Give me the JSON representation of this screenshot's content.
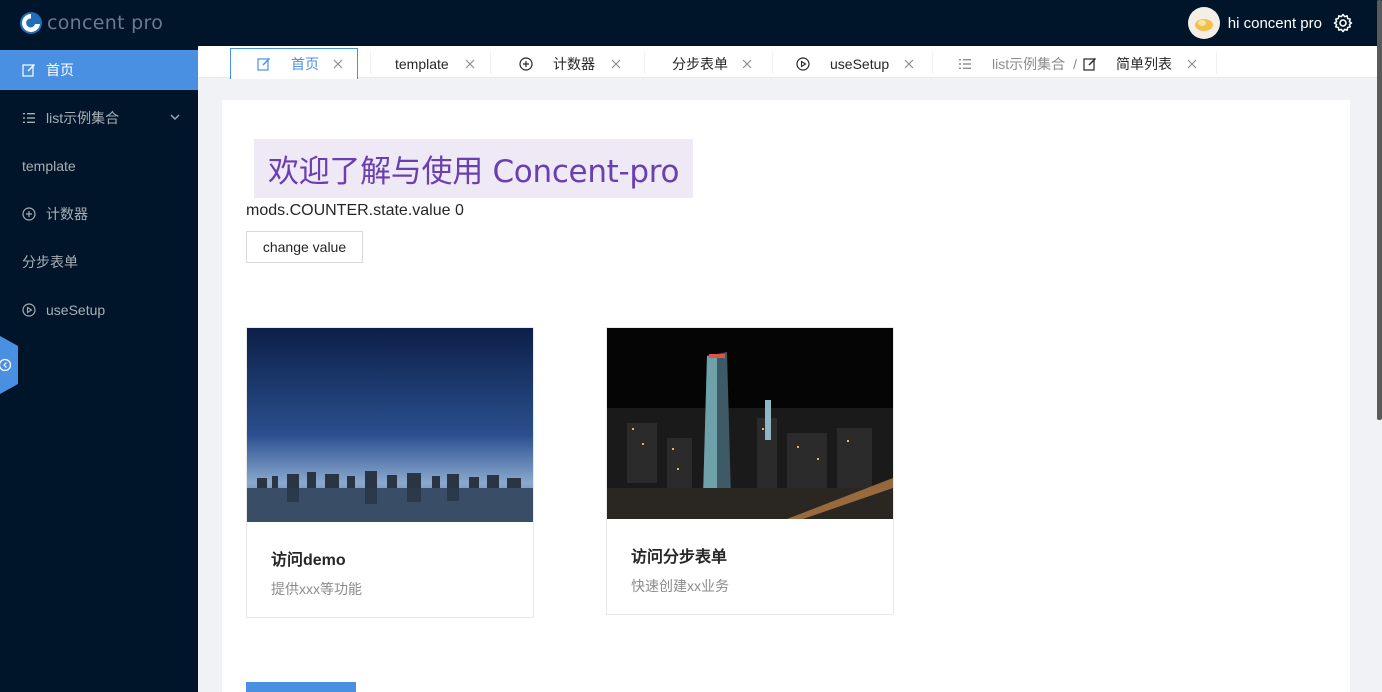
{
  "app": {
    "logo_text": "concent pro",
    "user_greeting": "hi concent pro"
  },
  "sidebar": {
    "items": [
      {
        "label": "首页",
        "icon": "edit-icon",
        "active": true
      },
      {
        "label": "list示例集合",
        "icon": "list-icon",
        "has_submenu": true
      },
      {
        "label": "template"
      },
      {
        "label": "计数器",
        "icon": "plus-circle-icon"
      },
      {
        "label": "分步表单"
      },
      {
        "label": "useSetup",
        "icon": "play-circle-icon"
      }
    ]
  },
  "tabs": [
    {
      "label": "首页",
      "icon": "edit-icon",
      "active": true
    },
    {
      "label": "template"
    },
    {
      "label": "计数器",
      "icon": "plus-circle-icon"
    },
    {
      "label": "分步表单"
    },
    {
      "label": "useSetup",
      "icon": "play-circle-icon"
    },
    {
      "parent": "list示例集合",
      "separator": "/",
      "label": "简单列表",
      "icon": "edit-icon",
      "parent_icon": "list-icon"
    }
  ],
  "main": {
    "welcome_title": "欢迎了解与使用 Concent-pro",
    "counter_text": "mods.COUNTER.state.value 0",
    "change_button": "change value",
    "cards": [
      {
        "title": "访问demo",
        "desc": "提供xxx等功能",
        "image": "city-skyline-dusk"
      },
      {
        "title": "访问分步表单",
        "desc": "快速创建xx业务",
        "image": "city-skyline-night"
      }
    ]
  },
  "colors": {
    "header_bg": "#001529",
    "accent": "#4a90e2",
    "welcome_text": "#6a3fb0",
    "welcome_bg": "#efe9f5"
  }
}
